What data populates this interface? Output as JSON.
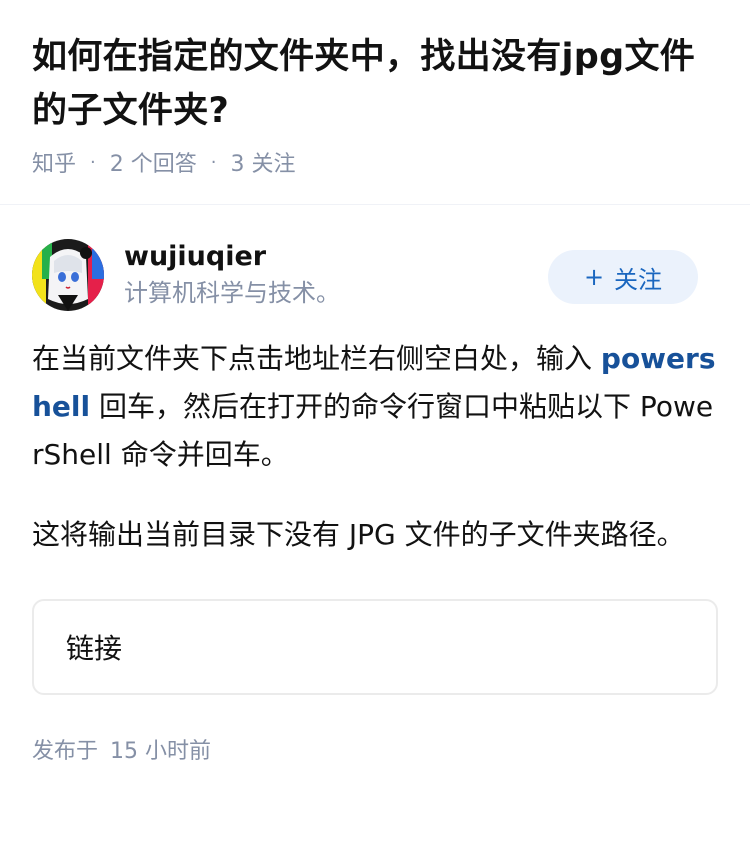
{
  "question": {
    "title": "如何在指定的文件夹中，找出没有jpg文件的子文件夹?",
    "source": "知乎",
    "answers_count": "2 个回答",
    "followers_count": "3 关注"
  },
  "answer": {
    "author_name": "wujiuqier",
    "author_bio": "计算机科学与技术。",
    "follow_label": "关注",
    "follow_icon": "plus-icon",
    "content_part1": "在当前文件夹下点击地址栏右侧空白处，输入 ",
    "content_link": "powershell",
    "content_part2": " 回车，然后在打开的命令行窗口中粘贴以下 PowerShell 命令并回车。",
    "content_para2": "这将输出当前目录下没有 JPG 文件的子文件夹路径。",
    "link_card_label": "链接",
    "publish_prefix": "发布于",
    "publish_time": "15 小时前"
  },
  "colors": {
    "accent": "#1a66bf",
    "link": "#175199",
    "muted": "#8590a6",
    "follow_bg": "#ebf2fc"
  }
}
